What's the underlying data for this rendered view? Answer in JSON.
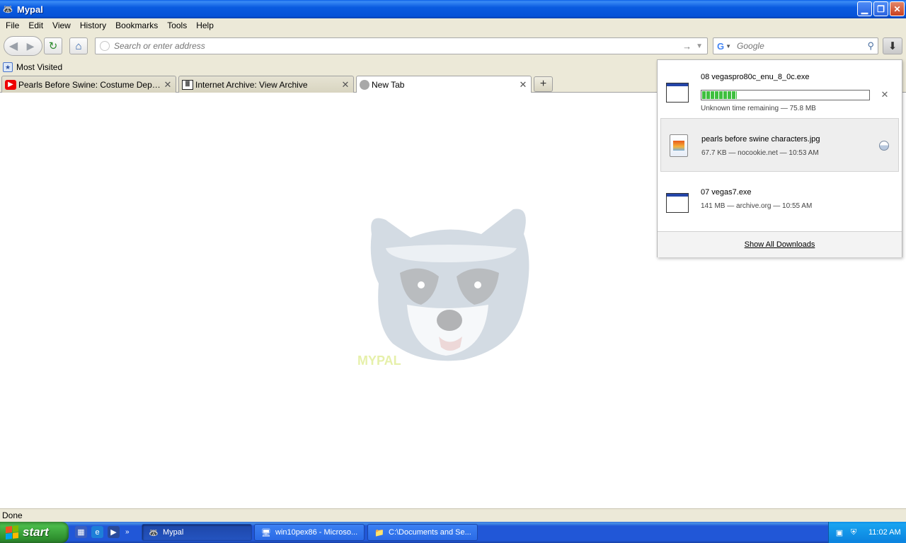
{
  "window": {
    "title": "Mypal"
  },
  "menu": [
    "File",
    "Edit",
    "View",
    "History",
    "Bookmarks",
    "Tools",
    "Help"
  ],
  "navbar": {
    "url_placeholder": "Search or enter address",
    "search_placeholder": "Google"
  },
  "bookmarks": {
    "most_visited": "Most Visited"
  },
  "tabs": [
    {
      "label": "Pearls Before Swine: Costume Departme...",
      "icon": "youtube-icon"
    },
    {
      "label": "Internet Archive: View Archive",
      "icon": "internet-archive-icon"
    },
    {
      "label": "New Tab",
      "icon": "globe-icon"
    }
  ],
  "content": {
    "logo_text": "MYPAL"
  },
  "status": {
    "text": "Done"
  },
  "downloads": {
    "items": [
      {
        "name": "08 vegaspro80c_enu_8_0c.exe",
        "meta": "Unknown time remaining — 75.8 MB",
        "progress": 0.21,
        "icon": "executable-icon",
        "action": "cancel-icon"
      },
      {
        "name": "pearls before swine characters.jpg",
        "meta": "67.7 KB — nocookie.net — 10:53 AM",
        "icon": "image-file-icon",
        "action": "open-folder-icon"
      },
      {
        "name": "07 vegas7.exe",
        "meta": "141 MB — archive.org — 10:55 AM",
        "icon": "executable-icon"
      }
    ],
    "show_all": "Show All Downloads"
  },
  "taskbar": {
    "start_label": "start",
    "tasks": [
      {
        "label": "Mypal",
        "icon": "mypal-icon"
      },
      {
        "label": "win10pex86 - Microso...",
        "icon": "computer-icon"
      },
      {
        "label": "C:\\Documents and Se...",
        "icon": "folder-icon"
      }
    ],
    "clock": "11:02 AM"
  },
  "colors": {
    "titlebar": "#0a5be0",
    "taskbar": "#2157d7",
    "start": "#3c9a3c",
    "progress": "#3fbf3f"
  }
}
